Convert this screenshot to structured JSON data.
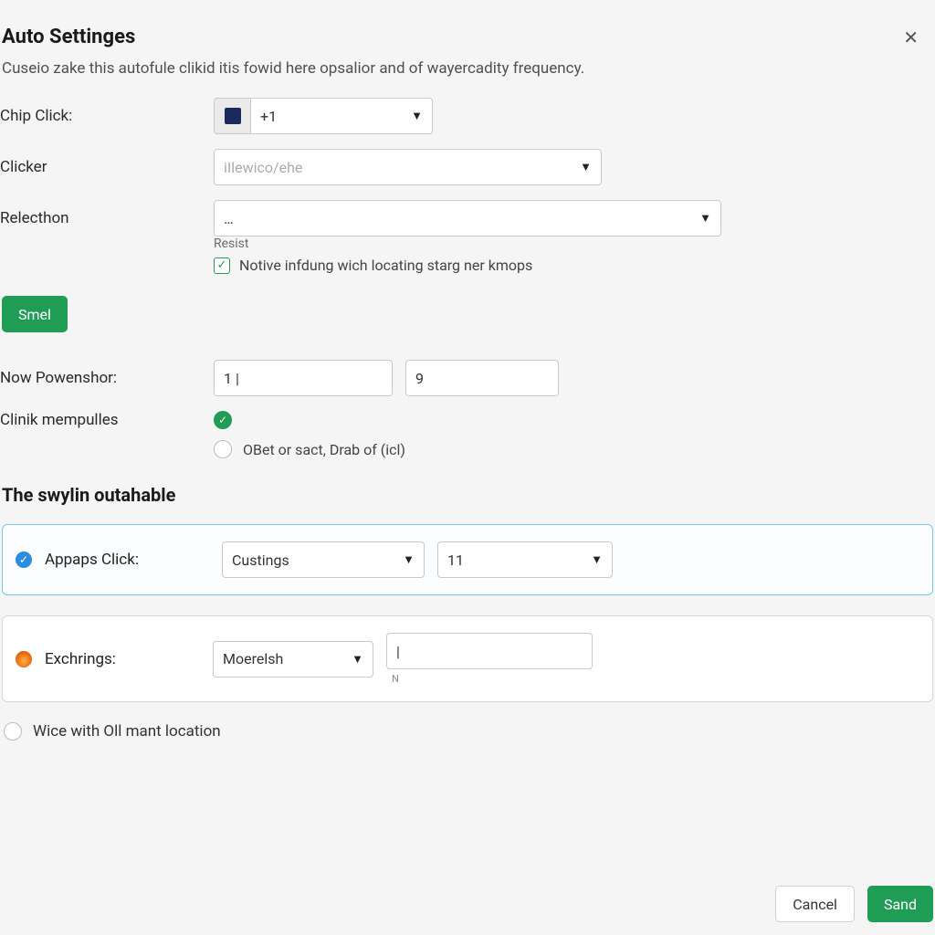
{
  "header": {
    "title": "Auto Settinges"
  },
  "subtitle": "Cuseio zake this autofule clikid itis fowid here opsalior and of wayercadity frequency.",
  "fields": {
    "chip_click_label": "Chip Click:",
    "chip_click_value": "+1",
    "clicker_label": "Clicker",
    "clicker_placeholder": "iIlewico/ehe",
    "relection_label": "Relecthon",
    "relection_value": "…",
    "relection_hint": "Resist",
    "notify_checkbox_label": "Notive infdung wich locating starg ner kmops",
    "smel_button": "Smel",
    "now_power_label": "Now Powenshor:",
    "now_power_value1": "1 |",
    "now_power_value2": "9",
    "clinik_label": "Clinik mempulles",
    "drab_radio_label": "OBet or sact, Drab of (icl)"
  },
  "section2_title": "The swylin outahable",
  "panel1": {
    "label": "Appaps Click:",
    "select_value": "Custings",
    "select2_value": "11"
  },
  "panel2": {
    "label": "Exchrings:",
    "select_value": "Moerelsh",
    "input_value": "|",
    "hint": "N"
  },
  "bottom_radio_label": "Wice with Oll mant location",
  "footer": {
    "cancel": "Cancel",
    "save": "Sand"
  }
}
